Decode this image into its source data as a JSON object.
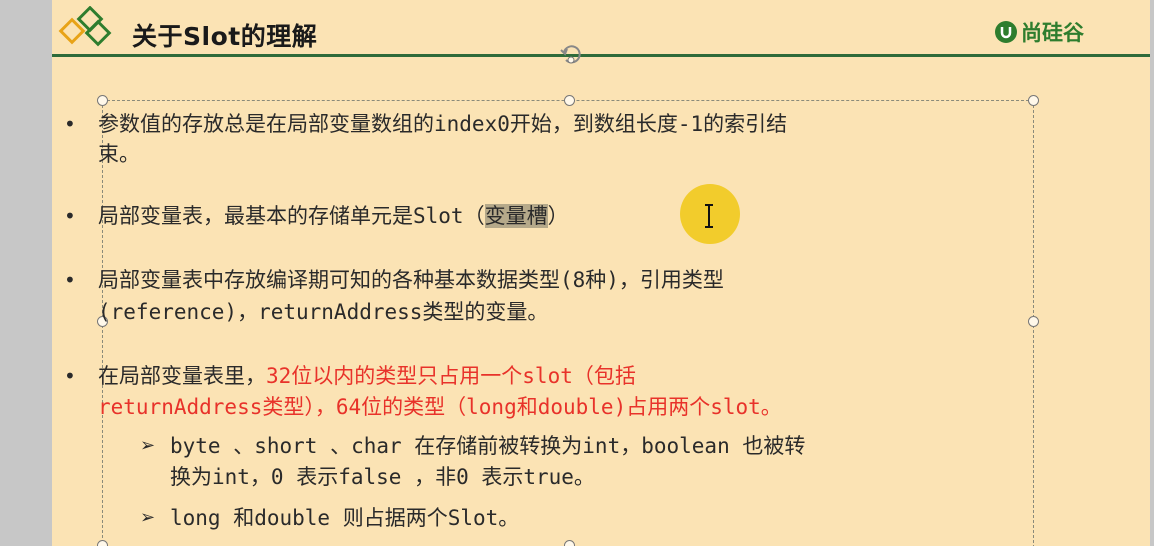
{
  "slide": {
    "title": "关于Slot的理解",
    "brand": "尚硅谷",
    "colors": {
      "background": "#fbe3b4",
      "header_rule": "#2f6b3a",
      "accent_red": "#e8322a",
      "brand_green": "#2e7d2e"
    }
  },
  "bullets": {
    "b1": {
      "l1": "参数值的存放总是在局部变量数组的index0开始，到数组长度-1的索引结",
      "l2": "束。"
    },
    "b2": {
      "l1a": "局部变量表，最基本的存储单元是Slot（",
      "l1_highlight": "变量槽",
      "l1b": "）"
    },
    "b3": {
      "l1": "局部变量表中存放编译期可知的各种基本数据类型(8种)，引用类型",
      "l2": "(reference)，returnAddress类型的变量。"
    },
    "b4": {
      "l1a": "在局部变量表里，",
      "l1_red": "32位以内的类型只占用一个slot（包括",
      "l2_red": "returnAddress类型），64位的类型（long和double)占用两个slot。"
    },
    "sub1": {
      "l1": "byte 、short 、char 在存储前被转换为int，boolean 也被转",
      "l2": "换为int，0 表示false ，非0 表示true。"
    },
    "sub2": {
      "l1": "long 和double 则占据两个Slot。"
    }
  },
  "icons": {
    "bullet": "•",
    "sub_bullet": "➢",
    "logo": "diamond-logo-icon",
    "rotate": "rotate-handle-icon",
    "cursor": "text-cursor-icon"
  }
}
